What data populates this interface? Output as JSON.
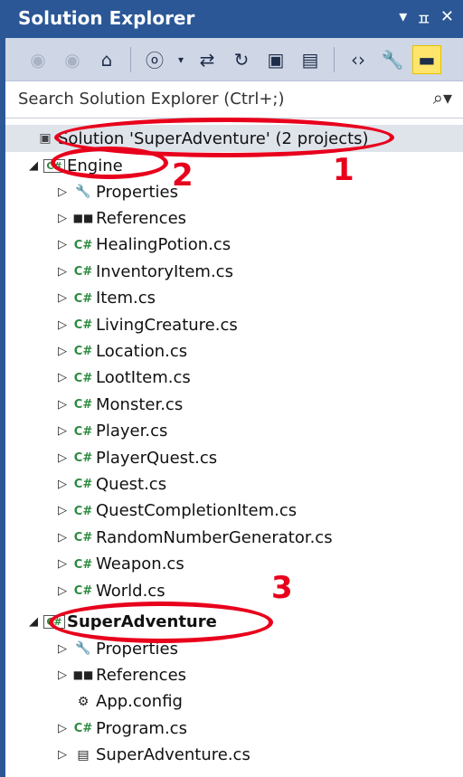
{
  "window": {
    "title": "Solution Explorer",
    "controls": [
      "▾",
      "ㅍ",
      "✕"
    ]
  },
  "search": {
    "placeholder": "Search Solution Explorer (Ctrl+;)",
    "icon": "search-icon"
  },
  "tree": {
    "solution": "Solution 'SuperAdventure' (2 projects)",
    "engine": {
      "name": "Engine",
      "items": [
        {
          "label": "Properties",
          "icon": "wrench-icon"
        },
        {
          "label": "References",
          "icon": "references-icon"
        },
        {
          "label": "HealingPotion.cs",
          "icon": "csharp-file-icon"
        },
        {
          "label": "InventoryItem.cs",
          "icon": "csharp-file-icon"
        },
        {
          "label": "Item.cs",
          "icon": "csharp-file-icon"
        },
        {
          "label": "LivingCreature.cs",
          "icon": "csharp-file-icon"
        },
        {
          "label": "Location.cs",
          "icon": "csharp-file-icon"
        },
        {
          "label": "LootItem.cs",
          "icon": "csharp-file-icon"
        },
        {
          "label": "Monster.cs",
          "icon": "csharp-file-icon"
        },
        {
          "label": "Player.cs",
          "icon": "csharp-file-icon"
        },
        {
          "label": "PlayerQuest.cs",
          "icon": "csharp-file-icon"
        },
        {
          "label": "Quest.cs",
          "icon": "csharp-file-icon"
        },
        {
          "label": "QuestCompletionItem.cs",
          "icon": "csharp-file-icon"
        },
        {
          "label": "RandomNumberGenerator.cs",
          "icon": "csharp-file-icon"
        },
        {
          "label": "Weapon.cs",
          "icon": "csharp-file-icon"
        },
        {
          "label": "World.cs",
          "icon": "csharp-file-icon"
        }
      ]
    },
    "superadventure": {
      "name": "SuperAdventure",
      "items": [
        {
          "label": "Properties",
          "icon": "wrench-icon"
        },
        {
          "label": "References",
          "icon": "references-icon"
        },
        {
          "label": "App.config",
          "icon": "config-icon"
        },
        {
          "label": "Program.cs",
          "icon": "csharp-file-icon"
        },
        {
          "label": "SuperAdventure.cs",
          "icon": "form-icon"
        }
      ]
    }
  },
  "annotations": {
    "one": "1",
    "two": "2",
    "three": "3"
  },
  "colors": {
    "titlebar": "#2b5797",
    "annotation": "#e8001c",
    "csharp": "#2b8a3e"
  }
}
